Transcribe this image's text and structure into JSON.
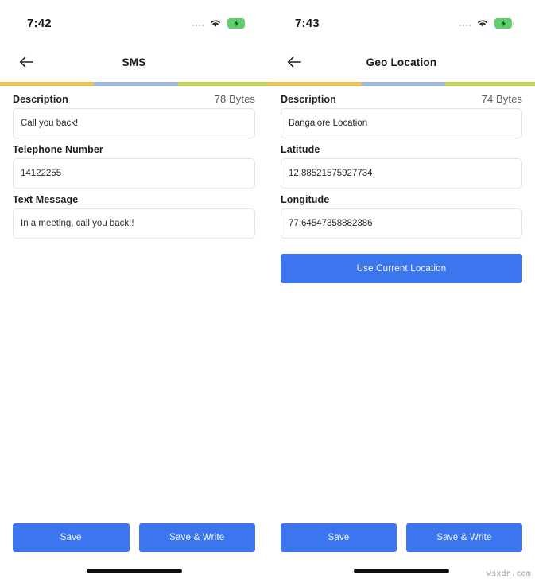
{
  "watermark": "wsxdn.com",
  "theme": {
    "primary_blue": "#3b76ef",
    "bar_yellow": "#efc14d",
    "bar_blue": "#9db7de",
    "bar_green": "#c3d44f",
    "label_color": "#1d1e20",
    "border_color": "#e2e3e5"
  },
  "screens": [
    {
      "status": {
        "time": "7:42",
        "signal_icon": "signal-dots-icon",
        "wifi_icon": "wifi-icon",
        "battery_icon": "battery-charging-icon"
      },
      "nav": {
        "back_icon": "arrow-left-icon",
        "title": "SMS"
      },
      "progress_segments": [
        "yellow",
        "blue",
        "green"
      ],
      "bytes_label": "78 Bytes",
      "fields": [
        {
          "label": "Description",
          "value": "Call you back!",
          "placeholder": "Description"
        },
        {
          "label": "Telephone Number",
          "value": "14122255",
          "placeholder": "Telephone Number"
        },
        {
          "label": "Text Message",
          "value": "In a meeting, call you back!!",
          "placeholder": "Text Message"
        }
      ],
      "actions": {
        "save": "Save",
        "save_write": "Save & Write"
      }
    },
    {
      "status": {
        "time": "7:43",
        "signal_icon": "signal-dots-icon",
        "wifi_icon": "wifi-icon",
        "battery_icon": "battery-charging-icon"
      },
      "nav": {
        "back_icon": "arrow-left-icon",
        "title": "Geo Location"
      },
      "progress_segments": [
        "yellow",
        "blue",
        "green"
      ],
      "bytes_label": "74 Bytes",
      "fields": [
        {
          "label": "Description",
          "value": "Bangalore Location",
          "placeholder": "Description"
        },
        {
          "label": "Latitude",
          "value": "12.88521575927734",
          "placeholder": "Latitude"
        },
        {
          "label": "Longitude",
          "value": "77.64547358882386",
          "placeholder": "Longitude"
        }
      ],
      "use_current_location": "Use Current Location",
      "actions": {
        "save": "Save",
        "save_write": "Save & Write"
      }
    }
  ]
}
